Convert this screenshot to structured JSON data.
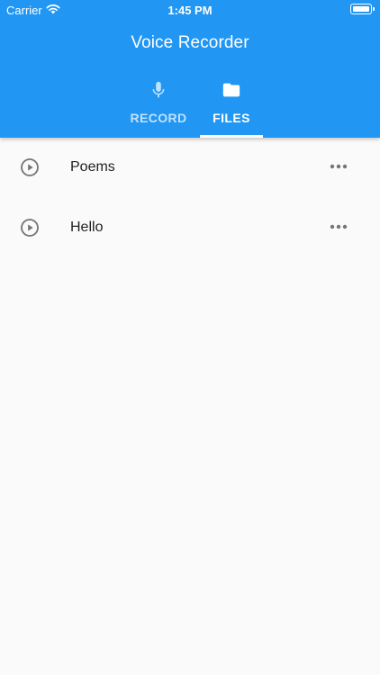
{
  "status_bar": {
    "carrier": "Carrier",
    "time": "1:45 PM",
    "icons": [
      "wifi-icon",
      "battery-icon"
    ]
  },
  "app_bar": {
    "title": "Voice Recorder",
    "background_color": "#2196f3"
  },
  "tabs": [
    {
      "label": "RECORD",
      "icon": "microphone-icon",
      "selected": false
    },
    {
      "label": "FILES",
      "icon": "folder-icon",
      "selected": true
    }
  ],
  "files": [
    {
      "name": "Poems",
      "icon": "play-circle-icon",
      "menu_icon": "more-horizontal-icon"
    },
    {
      "name": "Hello",
      "icon": "play-circle-icon",
      "menu_icon": "more-horizontal-icon"
    }
  ]
}
